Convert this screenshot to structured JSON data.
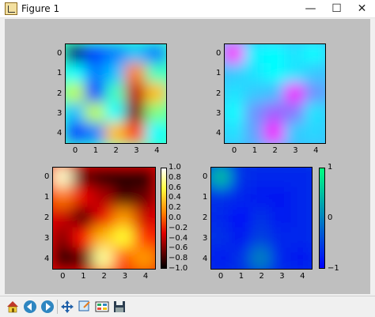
{
  "window": {
    "title": "Figure 1",
    "minimize": "—",
    "maximize": "☐",
    "close": "✕"
  },
  "toolbar": {
    "buttons": [
      {
        "name": "home-button",
        "icon": "home-icon"
      },
      {
        "name": "back-button",
        "icon": "back-arrow-icon"
      },
      {
        "name": "forward-button",
        "icon": "forward-arrow-icon"
      },
      {
        "name": "pan-button",
        "icon": "pan-icon"
      },
      {
        "name": "zoom-button",
        "icon": "zoom-icon"
      },
      {
        "name": "configure-subplots-button",
        "icon": "subplots-icon"
      },
      {
        "name": "save-button",
        "icon": "save-icon"
      }
    ]
  },
  "axes": {
    "tick_labels": [
      "0",
      "1",
      "2",
      "3",
      "4"
    ]
  },
  "colorbars": {
    "hot": [
      "1.0",
      "0.8",
      "0.6",
      "0.4",
      "0.2",
      "0.0",
      "−0.2",
      "−0.4",
      "−0.6",
      "−0.8",
      "−1.0"
    ],
    "winter": [
      "1",
      "0",
      "−1"
    ]
  },
  "chart_data": [
    {
      "type": "heatmap",
      "panel": "top-left",
      "colormap": "jet",
      "xlim": [
        -0.5,
        4.5
      ],
      "ylim": [
        4.5,
        -0.5
      ],
      "values": [
        [
          -0.9,
          -0.6,
          -0.5,
          -0.4,
          -0.5
        ],
        [
          -0.3,
          -0.5,
          -0.4,
          0.3,
          -0.2
        ],
        [
          0.0,
          -0.6,
          -0.2,
          0.6,
          0.2
        ],
        [
          -0.4,
          0.0,
          -0.3,
          0.7,
          -0.1
        ],
        [
          -0.6,
          -0.5,
          0.2,
          0.4,
          -0.3
        ]
      ]
    },
    {
      "type": "heatmap",
      "panel": "top-right",
      "colormap": "cool",
      "xlim": [
        -0.5,
        4.5
      ],
      "ylim": [
        4.5,
        -0.5
      ],
      "values": [
        [
          0.95,
          0.05,
          0.0,
          0.1,
          0.0
        ],
        [
          0.2,
          0.1,
          0.0,
          0.1,
          0.2
        ],
        [
          0.1,
          0.2,
          0.25,
          0.9,
          0.4
        ],
        [
          0.0,
          0.4,
          0.6,
          0.5,
          0.1
        ],
        [
          0.1,
          0.35,
          0.9,
          0.2,
          0.15
        ]
      ]
    },
    {
      "type": "heatmap",
      "panel": "bottom-left",
      "colormap": "hot",
      "xlim": [
        -0.5,
        4.5
      ],
      "ylim": [
        4.5,
        -0.5
      ],
      "clim": [
        -1.0,
        1.0
      ],
      "values": [
        [
          0.9,
          -0.7,
          -0.9,
          -0.9,
          -0.9
        ],
        [
          0.1,
          -0.3,
          -0.5,
          -0.8,
          -0.7
        ],
        [
          -0.4,
          -0.8,
          -0.3,
          0.2,
          -0.4
        ],
        [
          -0.6,
          -0.2,
          0.3,
          0.6,
          -0.1
        ],
        [
          -0.9,
          -0.7,
          0.8,
          0.0,
          0.2
        ]
      ]
    },
    {
      "type": "heatmap",
      "panel": "bottom-right",
      "colormap": "winter",
      "xlim": [
        -0.5,
        4.5
      ],
      "ylim": [
        4.5,
        -0.5
      ],
      "clim": [
        -1,
        1
      ],
      "values": [
        [
          0.5,
          -0.6,
          -0.7,
          -0.7,
          -0.7
        ],
        [
          -0.6,
          -0.7,
          -0.8,
          -0.8,
          -0.7
        ],
        [
          -0.7,
          -0.9,
          -0.6,
          -0.8,
          -0.7
        ],
        [
          -0.6,
          -0.8,
          -0.5,
          -0.7,
          -0.7
        ],
        [
          -0.8,
          -0.6,
          0.0,
          -0.7,
          -0.8
        ]
      ]
    }
  ]
}
